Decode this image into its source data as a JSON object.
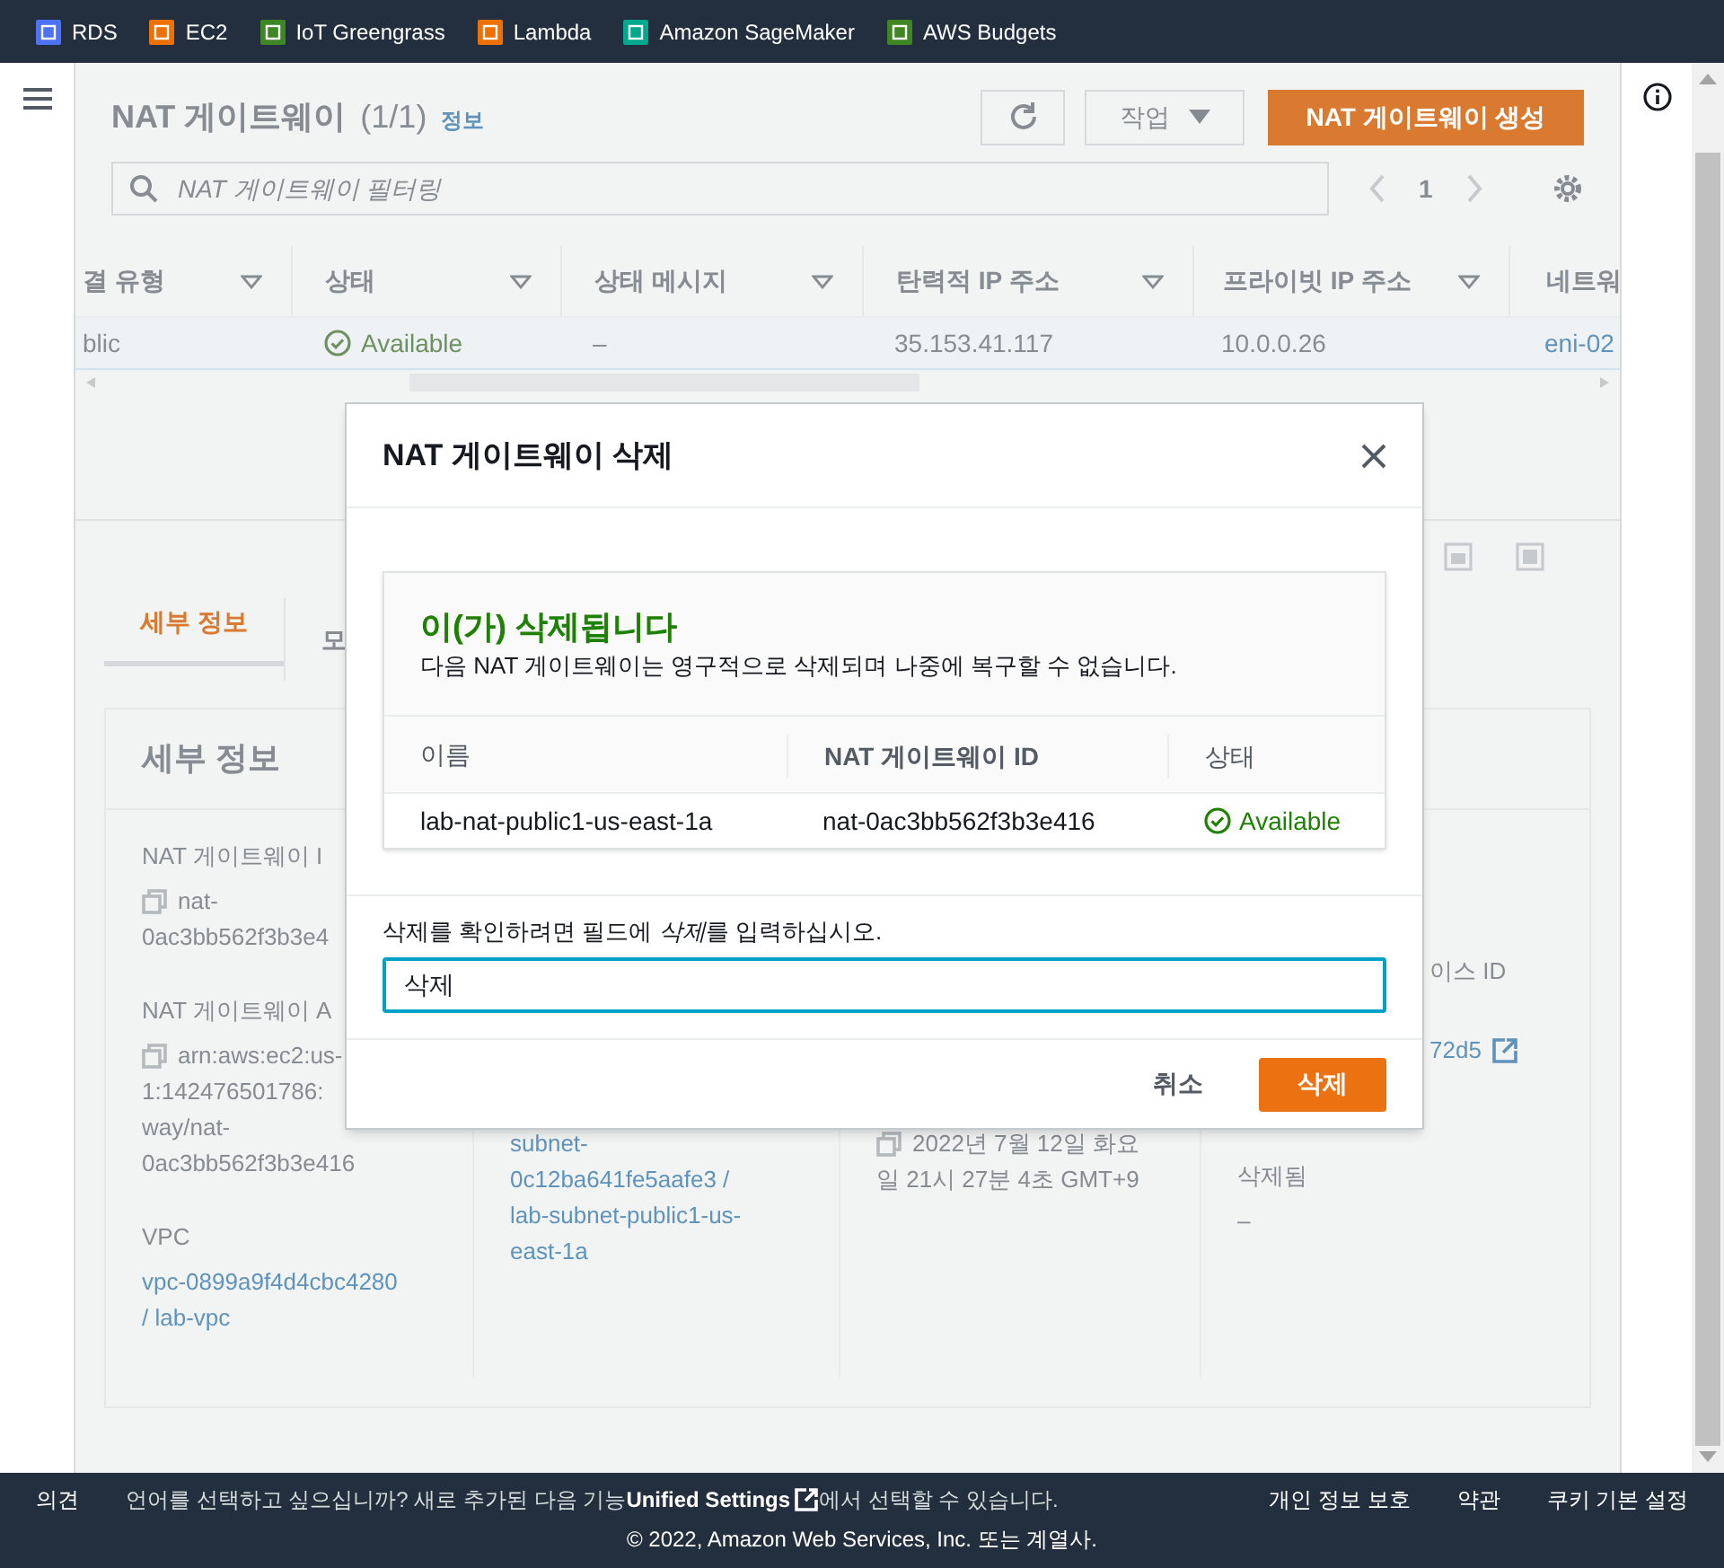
{
  "nav_services": [
    {
      "label": "RDS",
      "color": "#4d72f5"
    },
    {
      "label": "EC2",
      "color": "#ed7100"
    },
    {
      "label": "IoT Greengrass",
      "color": "#3f8624"
    },
    {
      "label": "Lambda",
      "color": "#ed7100"
    },
    {
      "label": "Amazon SageMaker",
      "color": "#01a88d"
    },
    {
      "label": "AWS Budgets",
      "color": "#3f8624"
    }
  ],
  "page_header": {
    "title": "NAT 게이트웨이",
    "count": "(1/1)",
    "info_link": "정보",
    "actions_button": "작업",
    "create_button": "NAT 게이트웨이 생성"
  },
  "filter": {
    "placeholder": "NAT 게이트웨이 필터링",
    "page": "1"
  },
  "table": {
    "columns": [
      "결 유형",
      "상태",
      "상태 메시지",
      "탄력적 IP 주소",
      "프라이빗 IP 주소",
      "네트워"
    ],
    "rows": [
      {
        "selected": true,
        "cells": [
          {
            "text": "blic",
            "kind": "text"
          },
          {
            "text": "Available",
            "kind": "status"
          },
          {
            "text": "–",
            "kind": "text"
          },
          {
            "text": "35.153.41.117",
            "kind": "text"
          },
          {
            "text": "10.0.0.26",
            "kind": "text"
          },
          {
            "text": "eni-02",
            "kind": "link"
          }
        ]
      }
    ]
  },
  "details": {
    "tabs": [
      {
        "label": "세부 정보",
        "selected": true
      },
      {
        "label": "모",
        "selected": false
      }
    ],
    "heading": "세부 정보",
    "columns": [
      [
        {
          "label": "NAT 게이트웨이 I",
          "lines": [
            "nat-",
            "0ac3bb562f3b3e4"
          ],
          "kind": "copy"
        },
        {
          "label": "NAT 게이트웨이 A",
          "lines": [
            "arn:aws:ec2:us-",
            "1:142476501786:",
            "way/nat-",
            "0ac3bb562f3b3e416"
          ],
          "kind": "copy"
        },
        {
          "label": "VPC",
          "lines": [
            "vpc-0899a9f4d4cbc4280",
            "/ lab-vpc"
          ],
          "kind": "link"
        }
      ],
      [
        {
          "lines": [
            "subnet-",
            "0c12ba641fe5aafe3 /",
            "lab-subnet-public1-us-",
            "east-1a"
          ],
          "kind": "link"
        }
      ],
      [
        {
          "lines": [
            "2022년 7월 12일 화요",
            "일 21시 27분 4초 GMT+9"
          ],
          "kind": "copy"
        }
      ],
      [
        {
          "label": "이스 ID",
          "lines": [
            "72d5"
          ],
          "kind": "external_link"
        },
        {
          "label": "삭제됨",
          "lines": [
            "–"
          ],
          "kind": "text"
        }
      ]
    ]
  },
  "dialog": {
    "title": "NAT 게이트웨이 삭제",
    "alert": {
      "title": "이(가) 삭제됩니다",
      "message": "다음 NAT 게이트웨이는 영구적으로 삭제되며 나중에 복구할 수 없습니다.",
      "columns": [
        "이름",
        "NAT 게이트웨이 ID",
        "상태"
      ],
      "rows": [
        {
          "name": "lab-nat-public1-us-east-1a",
          "gateway_id": "nat-0ac3bb562f3b3e416",
          "status": "Available"
        }
      ]
    },
    "confirm_label": {
      "before": "삭제를 확인하려면 필드에 ",
      "emphasis": "삭제",
      "after": "를 입력하십시오."
    },
    "confirm_value": "삭제",
    "cancel_button": "취소",
    "delete_button": "삭제"
  },
  "footer": {
    "feedback": "의견",
    "notice_before": "언어를 선택하고 싶으십니까? 새로 추가된 다음 기능",
    "notice_link": "Unified Settings",
    "notice_after": "에서 선택할 수 있습니다.",
    "links": [
      "개인 정보 보호",
      "약관",
      "쿠키 기본 설정"
    ],
    "copyright": "© 2022, Amazon Web Services, Inc. 또는 계열사."
  }
}
